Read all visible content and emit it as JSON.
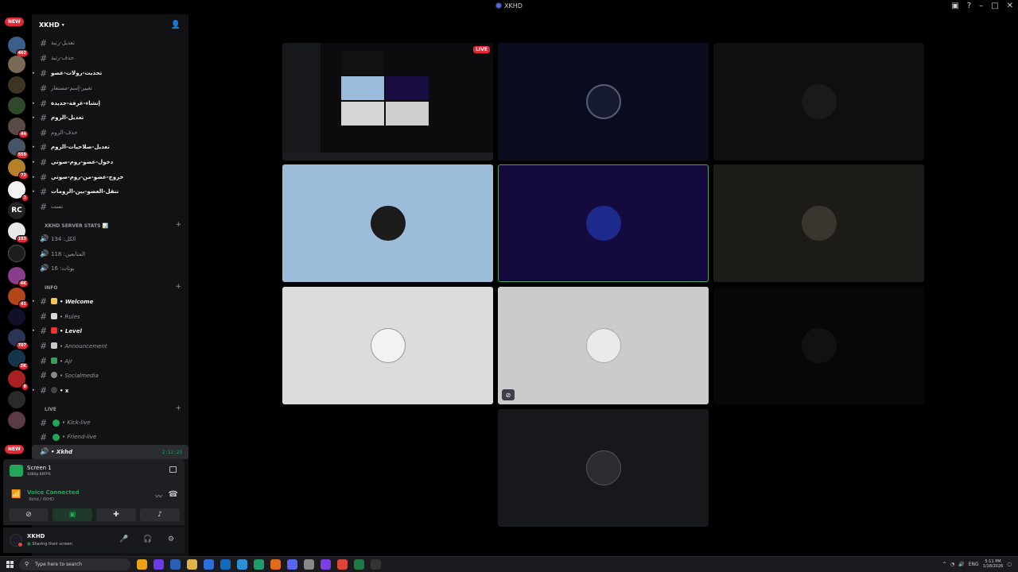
{
  "window": {
    "title": "XKHD"
  },
  "guilds": {
    "new_label": "NEW",
    "badges": [
      "462",
      "44",
      "559",
      "72",
      "1",
      "193",
      "4K",
      "41",
      "707",
      "2K",
      "9"
    ],
    "rc_label": "RC"
  },
  "server": {
    "name": "XKHD"
  },
  "channels_top": [
    "تعديل-رتبة",
    "حذف-رتبة",
    "تحديث-رولات-عضو",
    "تغيير-إسم-مستعار",
    "إنشاء-غرفة-جديدة",
    "تعديل-الروم",
    "حذف-الروم",
    "تعديل-صلاحيات-الروم",
    "دخول-عضو-روم-صوتي",
    "خروج-عضو-من-روم-صوتي",
    "تنقل-العضو-بين-الرومات",
    "تست"
  ],
  "stats": {
    "category": "XKHD SERVER STATS 📊",
    "items": [
      "الكل: 134",
      "المتابعين: 118",
      "بوتات: 16"
    ]
  },
  "info": {
    "category": "INFO",
    "items": [
      "Welcome",
      "Rules",
      "Level",
      "Announcement",
      "Ajr",
      "Socialmedia",
      "x"
    ]
  },
  "live": {
    "category": "LIVE",
    "items": [
      "Kick-live",
      "Friend-live"
    ],
    "active_voice": "Xkhd",
    "timer": "2:12:23"
  },
  "stream": {
    "title": "Screen 1",
    "subtitle": "1080p 60FPS"
  },
  "voice": {
    "status": "Voice Connected",
    "location": "Xkhd / XKHD"
  },
  "user": {
    "name": "XKHD",
    "status": "Sharing their screen"
  },
  "stage": {
    "live_badge": "LIVE"
  },
  "taskbar": {
    "search_placeholder": "Type here to search",
    "lang": "ENG",
    "time": "5:11 PM",
    "date": "1/18/2026"
  },
  "colors": {
    "accent": "#5865f2",
    "green": "#23a55a",
    "red": "#e22a37"
  }
}
